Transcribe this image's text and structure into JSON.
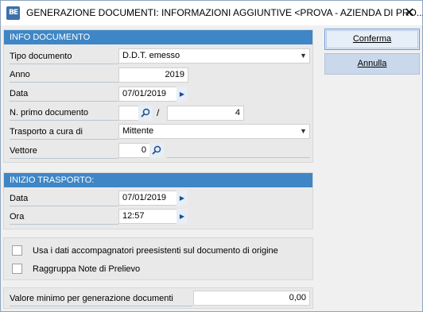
{
  "window": {
    "title": "GENERAZIONE DOCUMENTI: INFORMAZIONI AGGIUNTIVE <PROVA - AZIENDA DI PRO...",
    "app_icon_text": "BE",
    "close_glyph": "✕"
  },
  "info_documento": {
    "header": "INFO DOCUMENTO",
    "tipo_documento": {
      "label": "Tipo documento",
      "value": "D.D.T. emesso"
    },
    "anno": {
      "label": "Anno",
      "value": "2019"
    },
    "data": {
      "label": "Data",
      "value": "07/01/2019"
    },
    "n_primo_documento": {
      "label": "N. primo documento",
      "series": "",
      "separator": "/",
      "value": "4"
    },
    "trasporto": {
      "label": "Trasporto a cura di",
      "value": "Mittente"
    },
    "vettore": {
      "label": "Vettore",
      "value": "0",
      "description": ""
    }
  },
  "inizio_trasporto": {
    "header": "INIZIO TRASPORTO:",
    "data": {
      "label": "Data",
      "value": "07/01/2019"
    },
    "ora": {
      "label": "Ora",
      "value": "12:57"
    }
  },
  "options": {
    "usa_dati": {
      "label": "Usa i dati accompagnatori preesistenti sul documento di origine",
      "checked": false
    },
    "raggruppa": {
      "label": "Raggruppa Note di Prelievo",
      "checked": false
    }
  },
  "valore_minimo": {
    "label": "Valore minimo per generazione documenti",
    "value": "0,00"
  },
  "buttons": {
    "confirm": "Conferma",
    "cancel": "Annulla"
  },
  "colors": {
    "header_blue": "#3e86c5",
    "panel_bg": "#e9e9e9",
    "button_blue": "#c9d8ea"
  }
}
